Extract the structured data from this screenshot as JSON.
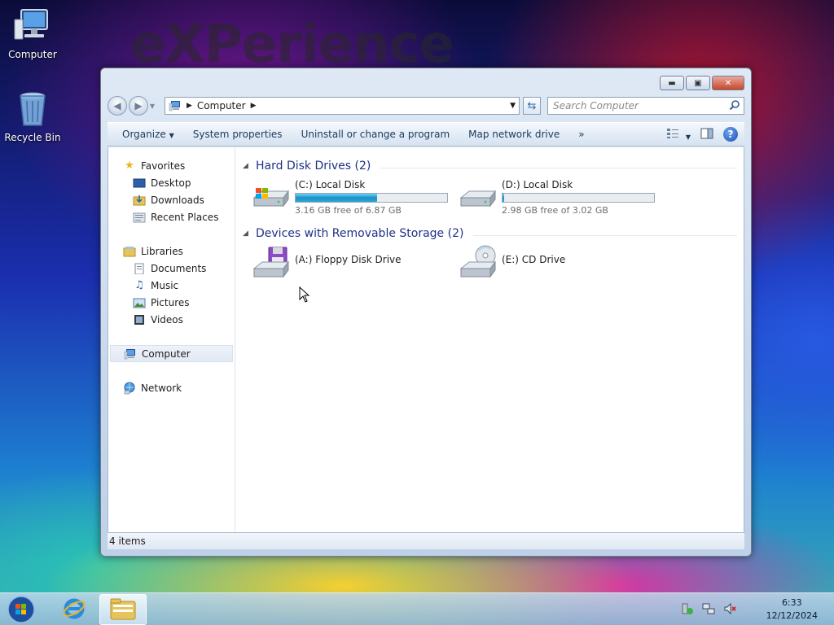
{
  "desktop": {
    "watermark": "eXPerience",
    "icons": [
      {
        "label": "Computer",
        "icon": "computer-icon"
      },
      {
        "label": "Recycle Bin",
        "icon": "recycle-bin-icon"
      }
    ]
  },
  "window": {
    "address": {
      "crumb": "Computer"
    },
    "search": {
      "placeholder": "Search Computer"
    },
    "toolbar": {
      "organize": "Organize",
      "system_properties": "System properties",
      "uninstall": "Uninstall or change a program",
      "map_drive": "Map network drive",
      "more": "»"
    },
    "nav": {
      "favorites": "Favorites",
      "desktop": "Desktop",
      "downloads": "Downloads",
      "recent": "Recent Places",
      "libraries": "Libraries",
      "documents": "Documents",
      "music": "Music",
      "pictures": "Pictures",
      "videos": "Videos",
      "computer": "Computer",
      "network": "Network"
    },
    "groups": {
      "hdd": {
        "title": "Hard Disk Drives (2)",
        "drives": [
          {
            "name": "(C:) Local Disk",
            "free": "3.16 GB free of 6.87 GB",
            "used_fraction": 0.54
          },
          {
            "name": "(D:) Local Disk",
            "free": "2.98 GB free of 3.02 GB",
            "used_fraction": 0.013
          }
        ]
      },
      "removable": {
        "title": "Devices with Removable Storage (2)",
        "drives": [
          {
            "name": "(A:) Floppy Disk Drive"
          },
          {
            "name": "(E:) CD Drive"
          }
        ]
      }
    },
    "status": "4 items"
  },
  "taskbar": {
    "time": "6:33",
    "date": "12/12/2024"
  },
  "colors": {
    "group_header": "#1e3287",
    "toolbar_text": "#1e395b",
    "bar_fill": "#1f8fc8",
    "close_button": "#c8452c"
  }
}
